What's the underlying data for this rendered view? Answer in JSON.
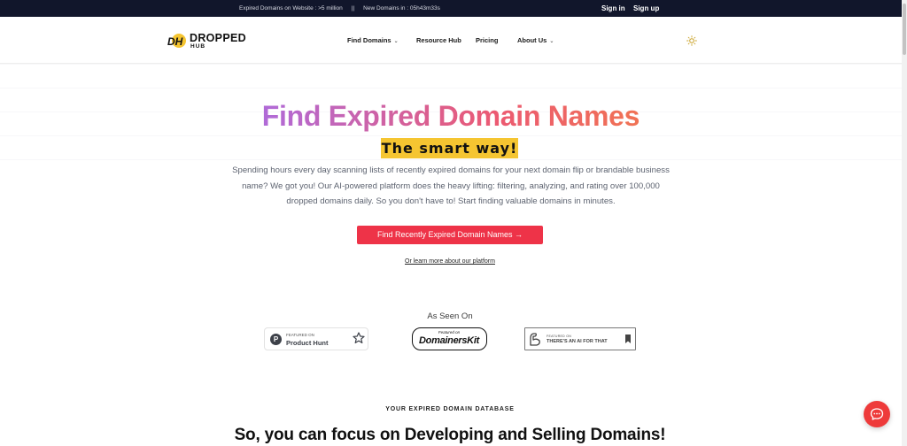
{
  "topbar": {
    "expired_label": "Expired Domains on Website : >5 million",
    "separator": "||",
    "new_label": "New Domains in : 05h43m33s",
    "signin": "Sign in",
    "signup": "Sign up"
  },
  "nav": {
    "logo_mark": "DH",
    "logo_word1": "DROPPED",
    "logo_word2": "HUB",
    "items": [
      {
        "label": "Find Domains",
        "chevron": "⌄"
      },
      {
        "label": "Resource Hub"
      },
      {
        "label": "Pricing"
      },
      {
        "label": "About Us",
        "chevron": "⌄"
      }
    ],
    "theme_icon": "sun-icon"
  },
  "hero": {
    "title": "Find Expired Domain Names",
    "highlight": "The smart way!",
    "description": "Spending hours every day scanning lists of recently expired domains for your next domain flip or brandable business name? We got you! Our AI-powered platform does the heavy lifting: filtering, analyzing, and rating over 100,000 dropped domains daily. So you don't have to! Start finding valuable domains in minutes.",
    "cta": "Find Recently Expired Domain Names →",
    "learn_more": "Or learn more about our platform"
  },
  "seen_on": {
    "title": "As Seen On",
    "producthunt": {
      "small": "FEATURED ON",
      "name": "Product Hunt",
      "mark": "P"
    },
    "domainerskit": {
      "small": "Featured on",
      "name": "DomainersKit"
    },
    "aiforthat": {
      "small": "FEATURED ON",
      "name": "THERE'S AN AI FOR THAT"
    }
  },
  "section": {
    "kicker": "YOUR EXPIRED DOMAIN DATABASE",
    "heading": "So, you can focus on Developing and Selling Domains!"
  },
  "colors": {
    "topbar": "#11162b",
    "cta": "#ee3348",
    "highlight": "#f5c531",
    "chat": "#ee3a3a"
  }
}
